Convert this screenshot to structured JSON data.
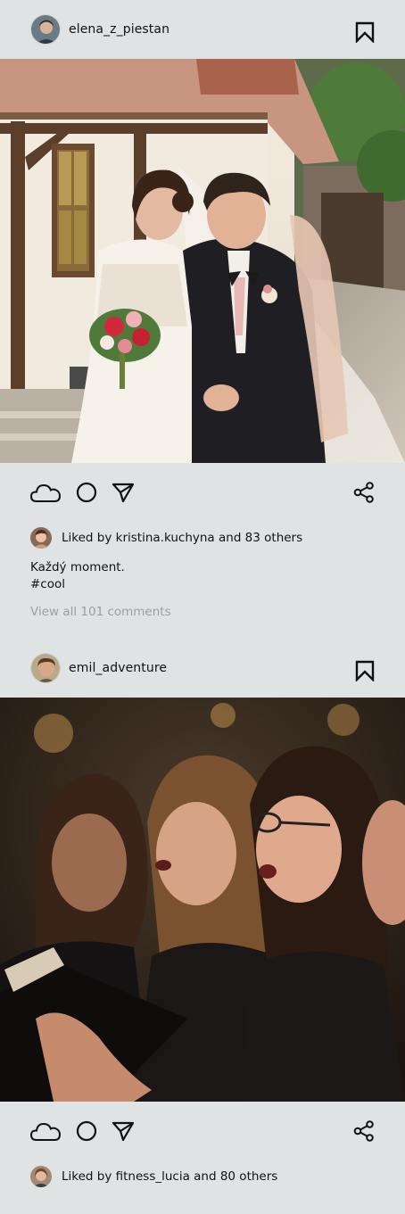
{
  "posts": [
    {
      "username": "elena_z_piestan",
      "likes_text": "Liked by kristina.kuchyna and 83 others",
      "caption_lines": [
        "Každý moment.",
        "#cool"
      ],
      "view_comments": "View all 101 comments",
      "photo_subject": "wedding couple walking"
    },
    {
      "username": "emil_adventure",
      "likes_text": "Liked by fitness_lucia and 80 others",
      "photo_subject": "choir singing"
    }
  ],
  "icons": {
    "like": "cloud-icon",
    "comment": "circle-icon",
    "send": "send-icon",
    "share": "share-icon",
    "bookmark": "bookmark-icon"
  },
  "colors": {
    "background": "#dfe3e4",
    "text": "#111111",
    "muted": "#9aa0a2"
  }
}
